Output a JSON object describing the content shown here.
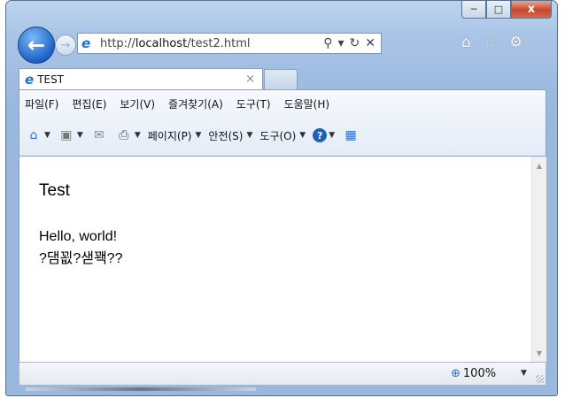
{
  "window": {
    "caption_buttons": {
      "minimize": "─",
      "maximize": "□",
      "close": "x"
    }
  },
  "nav": {
    "back_icon": "back-arrow-icon",
    "forward_icon": "forward-arrow-icon",
    "address": {
      "scheme": "http://",
      "host": "localhost",
      "path": "/test2.html"
    },
    "address_tools": {
      "search": "⚲",
      "dropdown": "▾",
      "refresh": "↻",
      "stop": "✕"
    },
    "right_icons": {
      "home": "⌂",
      "favorites": "☆",
      "settings": "⚙"
    }
  },
  "tab": {
    "title": "TEST",
    "close": "×"
  },
  "menu": {
    "items": [
      "파일(F)",
      "편집(E)",
      "보기(V)",
      "즐겨찾기(A)",
      "도구(T)",
      "도움말(H)"
    ]
  },
  "command_bar": {
    "page": "페이지(P)",
    "safety": "안전(S)",
    "tools": "도구(O)",
    "dropdown": "▼"
  },
  "content": {
    "title": "Test",
    "line1": "Hello, world!",
    "line2": "?댐꾒?샏꽥??"
  },
  "status": {
    "zoom": "100%",
    "dropdown": "▼"
  },
  "colors": {
    "accent": "#1d64c6",
    "close_button": "#c8452a",
    "frame": "#9ab8dd"
  }
}
